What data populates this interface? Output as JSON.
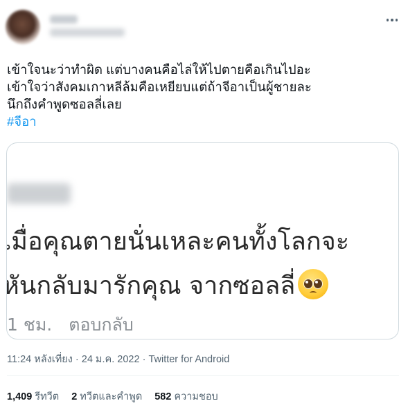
{
  "tweet": {
    "text_lines": [
      "เข้าใจนะว่าทำผิด แต่บางคนคือไล่ให้ไปตายคือเกินไปอะ",
      "เข้าใจว่าสังคมเกาหลีล้มคือเหยียบแต่ถ้าจีอาเป็นผู้ชายละ",
      "นึกถึงคำพูดซอลลี่เลย"
    ],
    "hashtag": "#จีอา"
  },
  "media": {
    "line1": "เมื่อคุณตายนั่นเหละคนทั้งโลกจะ",
    "line2": "หันกลับมารักคุณ จากซอลลี่",
    "time_ago": "1 ชม.",
    "reply_label": "ตอบกลับ"
  },
  "meta": {
    "time": "11:24 หลังเที่ยง",
    "separator": "·",
    "date": "24 ม.ค. 2022",
    "source": "Twitter for Android"
  },
  "stats": {
    "retweets_count": "1,409",
    "retweets_label": "รีทวีต",
    "quotes_count": "2",
    "quotes_label": "ทวีตและคำพูด",
    "likes_count": "582",
    "likes_label": "ความชอบ"
  },
  "icons": {
    "more": "more-horizontal-icon",
    "emoji": "pleading-face-emoji"
  }
}
